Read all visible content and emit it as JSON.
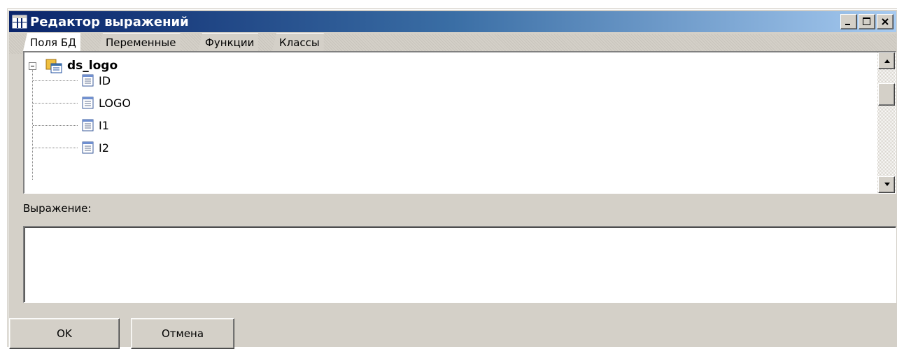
{
  "window": {
    "title": "Редактор выражений",
    "colors": {
      "title_start": "#0a246a",
      "title_end": "#a6caf0",
      "face": "#d4d0c8"
    }
  },
  "tabs": [
    {
      "label": "Поля БД",
      "active": true
    },
    {
      "label": "Переменные",
      "active": false
    },
    {
      "label": "Функции",
      "active": false
    },
    {
      "label": "Классы",
      "active": false
    }
  ],
  "tree": {
    "root": {
      "label": "ds_logo",
      "icon": "datasource-icon"
    },
    "items": [
      {
        "label": "ID",
        "icon": "field-icon"
      },
      {
        "label": "LOGO",
        "icon": "field-icon"
      },
      {
        "label": "I1",
        "icon": "field-icon"
      },
      {
        "label": "I2",
        "icon": "field-icon"
      }
    ]
  },
  "expression": {
    "label": "Выражение:",
    "value": ""
  },
  "buttons": {
    "ok": "OK",
    "cancel": "Отмена"
  }
}
